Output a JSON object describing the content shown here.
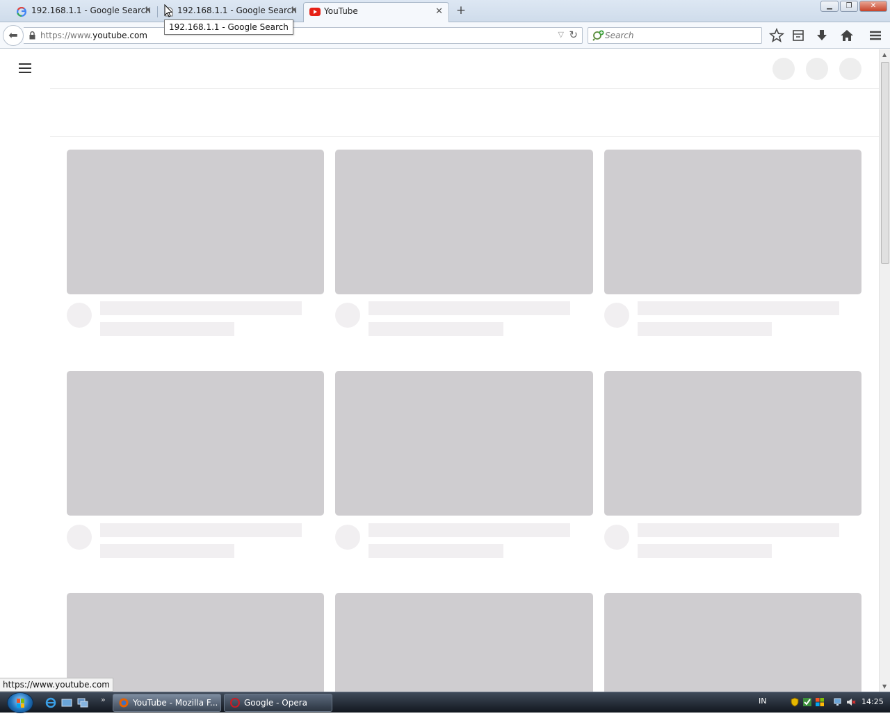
{
  "browser": {
    "tabs": [
      {
        "label": "192.168.1.1 - Google Search",
        "favicon": "google-icon",
        "active": false
      },
      {
        "label": "192.168.1.1 - Google Search",
        "favicon": "page-icon",
        "active": false
      },
      {
        "label": "YouTube",
        "favicon": "youtube-icon",
        "active": true
      }
    ],
    "tooltip": "192.168.1.1 - Google Search",
    "url_prefix": "https://www.",
    "url_domain": "youtube.com",
    "search_placeholder": "Search",
    "status_url": "https://www.youtube.com",
    "window_controls": [
      "minimize",
      "restore",
      "close"
    ]
  },
  "colors": {
    "skeleton_thumb": "#cfcdd0",
    "skeleton_line": "#f1eff1",
    "youtube_red": "#e62117"
  },
  "taskbar": {
    "items": [
      {
        "label": "YouTube - Mozilla F...",
        "icon": "firefox-icon",
        "active": true
      },
      {
        "label": "Google - Opera",
        "icon": "opera-icon",
        "active": false
      }
    ],
    "language": "IN",
    "clock": "14:25"
  }
}
